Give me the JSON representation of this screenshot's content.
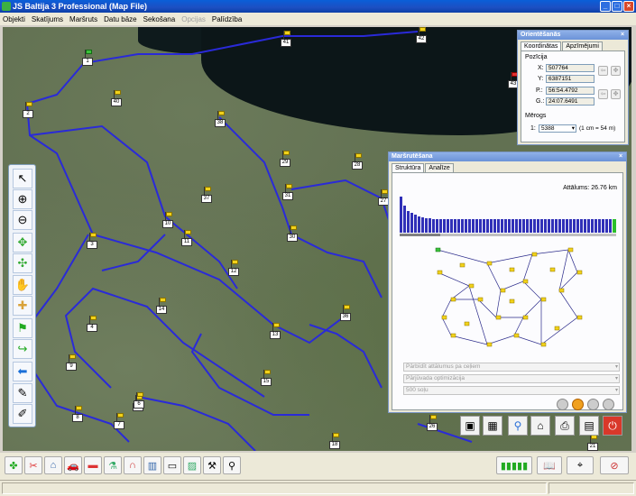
{
  "window": {
    "title": "JS Baltija 3 Professional (Map File)"
  },
  "menu": [
    {
      "label": "Objekti",
      "enabled": true
    },
    {
      "label": "Skatījums",
      "enabled": true
    },
    {
      "label": "Maršruts",
      "enabled": true
    },
    {
      "label": "Datu bāze",
      "enabled": true
    },
    {
      "label": "Sekošana",
      "enabled": true
    },
    {
      "label": "Opcijas",
      "enabled": false
    },
    {
      "label": "Palīdzība",
      "enabled": true
    }
  ],
  "map_flags": [
    "1",
    "2",
    "3",
    "4",
    "5",
    "6",
    "7",
    "8",
    "9",
    "10",
    "11",
    "12",
    "13",
    "14",
    "15",
    "18",
    "21",
    "26",
    "27",
    "28",
    "29",
    "30",
    "31",
    "36",
    "37",
    "38",
    "40",
    "41",
    "42",
    "43"
  ],
  "orientation_panel": {
    "title": "Orientēšanās",
    "tabs": [
      "Koordinātas",
      "Apzīmējumi"
    ],
    "position_group": "Pozīcija",
    "x_label": "X:",
    "x_value": "507764",
    "y_label": "Y:",
    "y_value": "6387151",
    "p_label": "P.:",
    "p_value": "56:54.4792",
    "g_label": "G.:",
    "g_value": "24:07.6491",
    "scale_group": "Mērogs",
    "scale_prefix": "1:",
    "scale_value": "5388",
    "scale_note": "(1 cm = 54 m)"
  },
  "route_panel": {
    "title": "Maršrutēšana",
    "tabs": [
      "Struktūra",
      "Analīze"
    ],
    "distance_label": "Attālums: 26.76 km",
    "sort_combo": "Pārbīdīt attālumus pa ceļiem",
    "optimize_combo": "Pārjūvada optimizācija",
    "steps_combo": "500 soļu"
  }
}
